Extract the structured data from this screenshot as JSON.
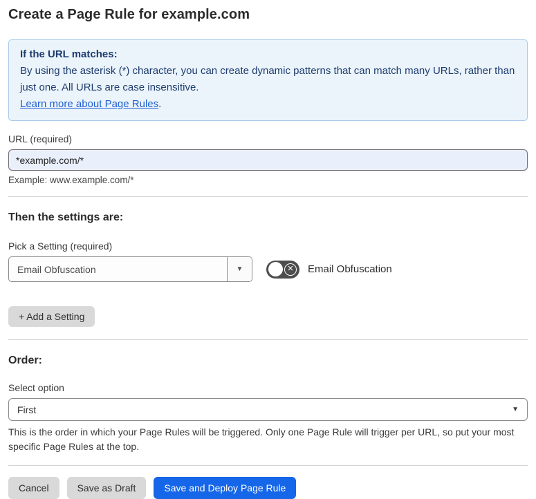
{
  "page": {
    "title": "Create a Page Rule for example.com"
  },
  "info_box": {
    "heading": "If the URL matches:",
    "body": "By using the asterisk (*) character, you can create dynamic patterns that can match many URLs, rather than just one. All URLs are case insensitive.",
    "link_label": "Learn more about Page Rules",
    "link_suffix": "."
  },
  "url_field": {
    "label": "URL (required)",
    "value": "*example.com/*",
    "example": "Example: www.example.com/*"
  },
  "settings": {
    "heading": "Then the settings are:",
    "pick_label": "Pick a Setting (required)",
    "selected_setting": "Email Obfuscation",
    "toggle_label": "Email Obfuscation",
    "toggle_state": "off",
    "add_button_label": "+ Add a Setting"
  },
  "order": {
    "heading": "Order:",
    "select_label": "Select option",
    "selected_option": "First",
    "help_text": "This is the order in which your Page Rules will be triggered. Only one Page Rule will trigger per URL, so put your most specific Page Rules at the top."
  },
  "actions": {
    "cancel_label": "Cancel",
    "save_draft_label": "Save as Draft",
    "save_deploy_label": "Save and Deploy Page Rule"
  },
  "icons": {
    "chevron_down": "▼",
    "toggle_x": "✕"
  },
  "colors": {
    "info_bg": "#ebf3fb",
    "info_border": "#a9c9ea",
    "info_text": "#1d3c6e",
    "link_blue": "#1f5fd1",
    "input_bg": "#e9effb",
    "primary_button_blue": "#1566e8",
    "gray_button": "#d9d9d9",
    "toggle_off": "#4d4d4d"
  }
}
